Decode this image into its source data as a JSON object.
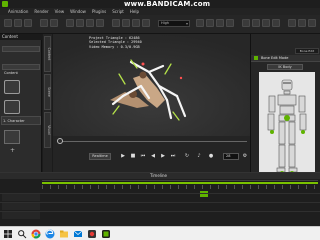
{
  "watermark": "www.BANDICAM.com",
  "menu": [
    "Animation",
    "Render",
    "View",
    "Window",
    "Plugins",
    "Script",
    "Help"
  ],
  "toolbar": {
    "quality": "High"
  },
  "left_panel": {
    "title": "Content",
    "folder_label": "Content",
    "tree_item": "1. Character",
    "add_label": "+"
  },
  "side_tabs": [
    "Content",
    "Scene",
    "Visual"
  ],
  "viewport": {
    "project_triangle": "Project Triangle : 62486",
    "selected_triangle": "Selected Triangle : 29940",
    "video_memory": "Video Memory : 0.3/0.9GB"
  },
  "playback": {
    "realtime_label": "Realtime",
    "frame": "28"
  },
  "right_panel": {
    "tab": "Bone Edit",
    "header": "Bone Edit Mode",
    "mode": "IK Body",
    "extend_bone": "Extend Bone",
    "default_button": "Default"
  },
  "timeline": {
    "title": "Timeline"
  },
  "colors": {
    "accent": "#5fb300",
    "bone": "#f5f5f5",
    "highlight": "#7ac100"
  },
  "icons": [
    "search-icon",
    "chrome-icon",
    "edge-icon",
    "file-explorer-icon",
    "bandicam-icon",
    "iclone-icon"
  ]
}
